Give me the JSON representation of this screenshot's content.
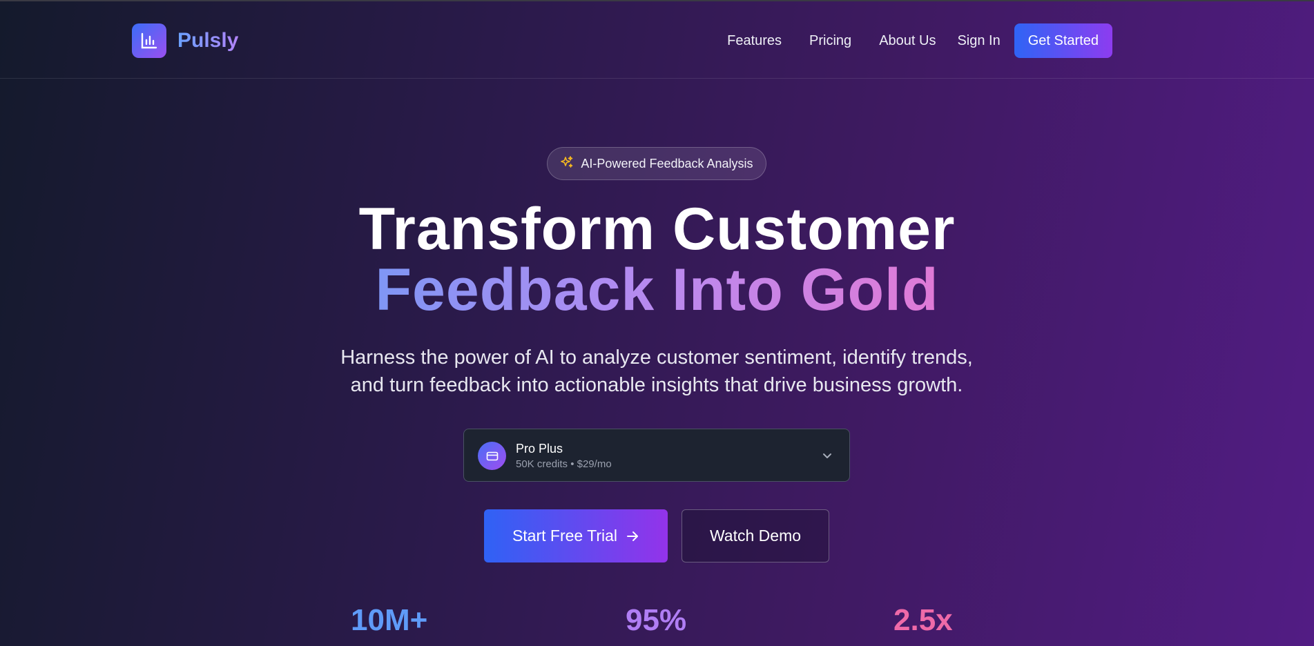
{
  "brand": {
    "name": "Pulsly",
    "logo_icon": "bar-chart-icon"
  },
  "nav": {
    "links": [
      "Features",
      "Pricing",
      "About Us"
    ],
    "sign_in": "Sign In",
    "get_started": "Get Started"
  },
  "hero": {
    "badge": {
      "icon": "sparkles-icon",
      "label": "AI-Powered Feedback Analysis"
    },
    "headline_line1": "Transform Customer",
    "headline_line2": "Feedback Into Gold",
    "subtext_line1": "Harness the power of AI to analyze customer sentiment, identify trends,",
    "subtext_line2": "and turn feedback into actionable insights that drive business growth."
  },
  "plan_select": {
    "icon": "credit-card-icon",
    "selected_name": "Pro Plus",
    "selected_detail": "50K credits • $29/mo"
  },
  "cta": {
    "primary_label": "Start Free Trial",
    "primary_icon": "arrow-right-icon",
    "secondary_label": "Watch Demo"
  },
  "stats": [
    {
      "value": "10M+"
    },
    {
      "value": "95%"
    },
    {
      "value": "2.5x"
    }
  ],
  "colors": {
    "accent_blue": "#2f64f5",
    "accent_purple": "#8d3cf0",
    "stat_blue": "#5f9bf8",
    "stat_purple": "#b07ef4",
    "stat_pink": "#ef6aa8"
  }
}
